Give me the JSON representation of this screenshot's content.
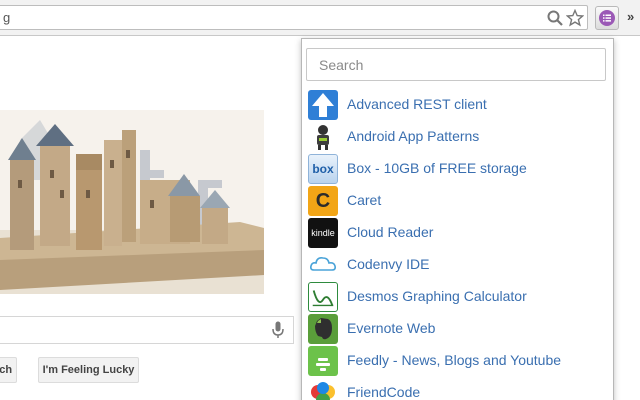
{
  "browser": {
    "address_text": "g",
    "extension_icon": "list-icon",
    "extension_color": "#9b59b6"
  },
  "google": {
    "search_button_label": "rch",
    "lucky_button_label": "I'm Feeling Lucky"
  },
  "popup": {
    "search_placeholder": "Search",
    "apps": [
      {
        "name": "Advanced REST client",
        "icon": "rest-arrow-icon"
      },
      {
        "name": "Android App Patterns",
        "icon": "android-figure-icon"
      },
      {
        "name": "Box - 10GB of FREE storage",
        "icon": "box-icon",
        "icon_text": "box"
      },
      {
        "name": "Caret",
        "icon": "caret-icon",
        "icon_text": "C"
      },
      {
        "name": "Cloud Reader",
        "icon": "kindle-icon",
        "icon_text": "kindle"
      },
      {
        "name": "Codenvy IDE",
        "icon": "codenvy-cloud-icon"
      },
      {
        "name": "Desmos Graphing Calculator",
        "icon": "desmos-icon"
      },
      {
        "name": "Evernote Web",
        "icon": "evernote-icon"
      },
      {
        "name": "Feedly - News, Blogs and Youtube",
        "icon": "feedly-icon"
      },
      {
        "name": "FriendCode",
        "icon": "friendcode-icon"
      }
    ]
  },
  "colors": {
    "link": "#3a6fb0",
    "accent": "#9b59b6"
  }
}
